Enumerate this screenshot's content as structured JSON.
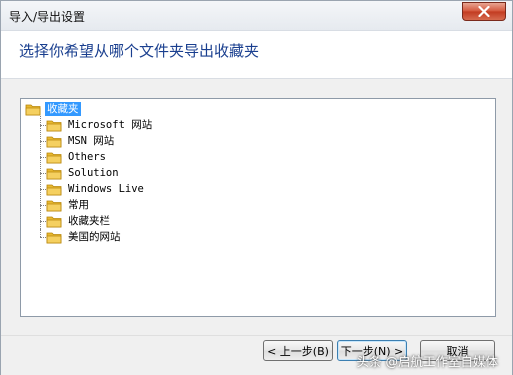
{
  "window": {
    "title": "导入/导出设置",
    "heading": "选择你希望从哪个文件夹导出收藏夹"
  },
  "tree": {
    "root": {
      "label": "收藏夹",
      "selected": true
    },
    "children": [
      {
        "label": "Microsoft 网站"
      },
      {
        "label": "MSN 网站"
      },
      {
        "label": "Others"
      },
      {
        "label": "Solution"
      },
      {
        "label": "Windows Live"
      },
      {
        "label": "常用"
      },
      {
        "label": "收藏夹栏"
      },
      {
        "label": "美国的网站"
      }
    ]
  },
  "buttons": {
    "back": "< 上一步(B)",
    "next": "下一步(N) >",
    "cancel": "取消"
  },
  "watermark": "头条 @启航工作室自媒体",
  "colors": {
    "heading": "#1a3f8f",
    "selection": "#3399ff",
    "folder": "#e8b830",
    "close_button": "#c94a2c"
  },
  "icons": {
    "folder": "folder-icon",
    "close": "close-icon"
  }
}
